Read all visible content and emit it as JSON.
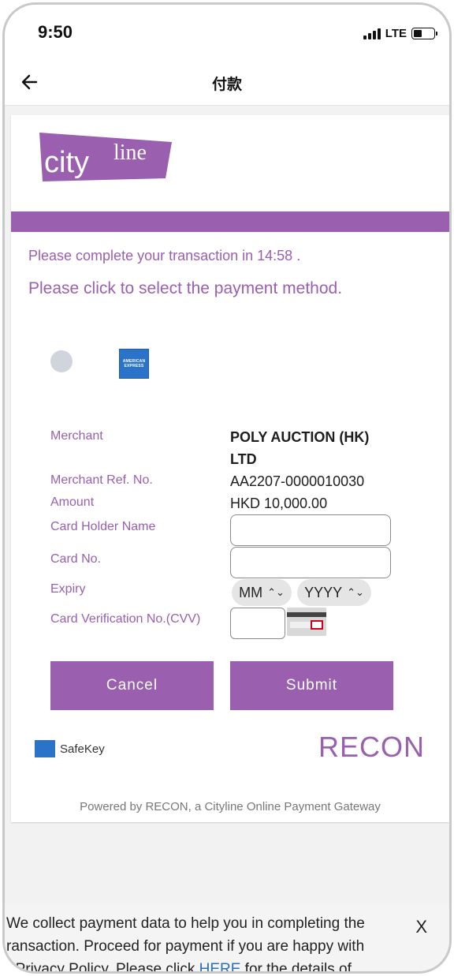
{
  "status_bar": {
    "time": "9:50",
    "network": "LTE"
  },
  "nav": {
    "title": "付款"
  },
  "logo": {
    "text1": "city",
    "text2": "line"
  },
  "messages": {
    "timer": "Please complete your transaction in 14:58 .",
    "select_method": "Please click to select the payment method."
  },
  "payment_methods": {
    "amex_line1": "AMERICAN",
    "amex_line2": "EXPRESS"
  },
  "form": {
    "merchant_label": "Merchant",
    "merchant_value_line1": "POLY AUCTION (HK)",
    "merchant_value_line2": "LTD",
    "ref_label": "Merchant Ref. No.",
    "ref_value": "AA2207-0000010030",
    "amount_label": "Amount",
    "amount_value": "HKD 10,000.00",
    "holder_label": "Card Holder Name",
    "card_label": "Card No.",
    "expiry_label": "Expiry",
    "expiry_month": "MM",
    "expiry_year": "YYYY",
    "cvv_label": "Card Verification No.(CVV)"
  },
  "buttons": {
    "cancel": "Cancel",
    "submit": "Submit"
  },
  "footer": {
    "safekey": "SafeKey",
    "recon": "RECON",
    "powered": "Powered by RECON, a Cityline Online Payment Gateway"
  },
  "notice": {
    "line1": "We collect payment data to help you in completing the",
    "line2": "ransaction. Proceed for payment if you are happy with",
    "line3_start": "r Privacy Policy. Please click ",
    "line3_link": "HERE",
    "line3_end": " for the details of",
    "close": "X"
  },
  "colors": {
    "accent": "#9a5fae",
    "amex_blue": "#2a73c9",
    "link": "#2b6fb6"
  }
}
